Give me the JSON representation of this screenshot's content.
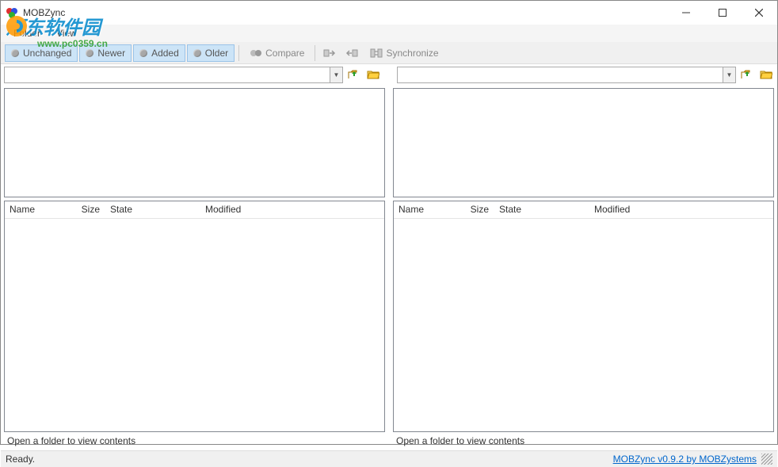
{
  "window": {
    "title": "MOBZync"
  },
  "menu": {
    "folder": "Folder",
    "view": "View"
  },
  "toolbar": {
    "unchanged": "Unchanged",
    "newer": "Newer",
    "added": "Added",
    "older": "Older",
    "compare": "Compare",
    "synchronize": "Synchronize"
  },
  "paths": {
    "left": "",
    "right": ""
  },
  "columns": {
    "name": "Name",
    "size": "Size",
    "state": "State",
    "modified": "Modified"
  },
  "pane_status": {
    "left": "Open a folder to view contents",
    "right": "Open a folder to view contents"
  },
  "status": {
    "ready": "Ready.",
    "link": "MOBZync v0.9.2 by MOBZystems"
  },
  "watermark": {
    "main": "河东软件园",
    "sub": "www.pc0359.cn"
  }
}
